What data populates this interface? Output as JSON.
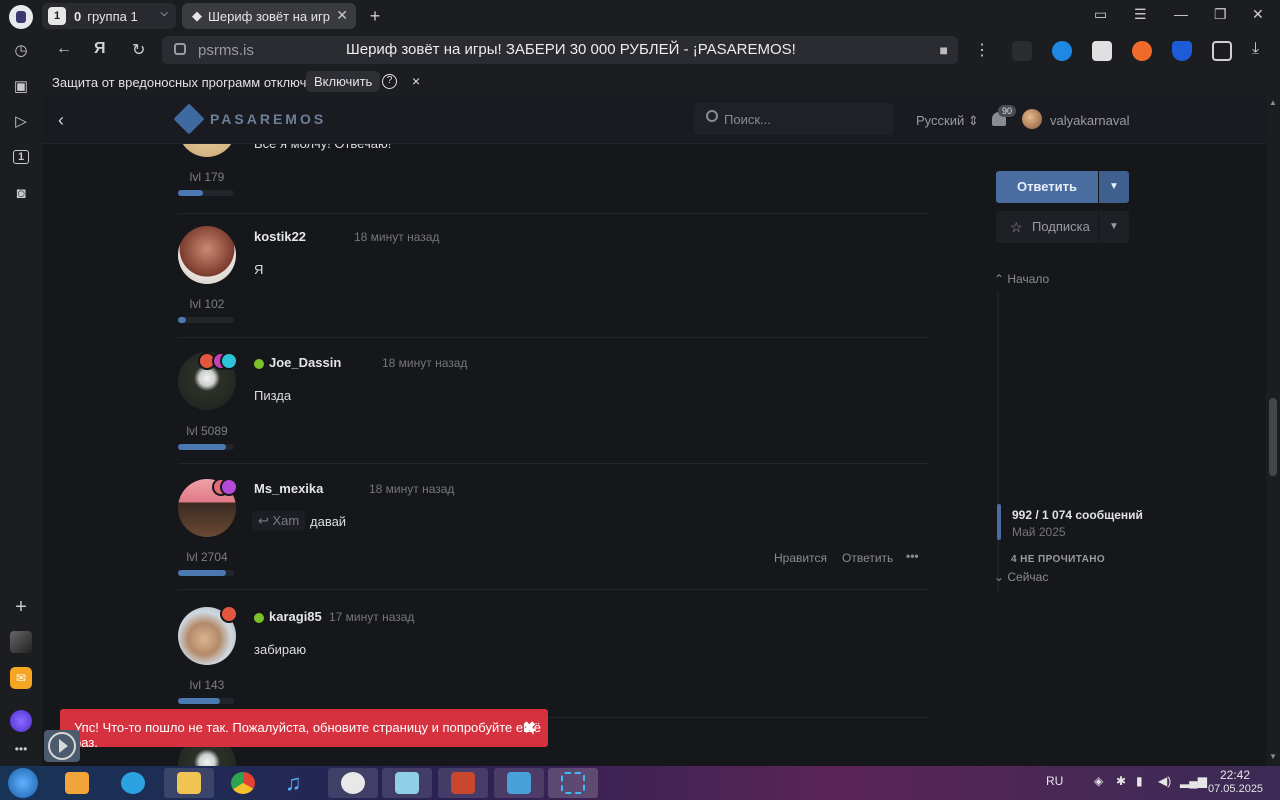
{
  "browser": {
    "tabs": {
      "group_count": "0",
      "group_label": "группа 1",
      "active_tab_title": "Шериф зовёт на игр",
      "tab_count_badge": "1"
    },
    "address": {
      "domain": "psrms.is",
      "page_title": "Шериф зовёт на игры! ЗАБЕРИ 30 000 РУБЛЕЙ - ¡PASAREMOS!"
    },
    "protection": {
      "message": "Защита от вредоносных программ отключена",
      "enable_label": "Включить",
      "help_glyph": "?",
      "close_glyph": "×"
    },
    "sidebar_badge": "1"
  },
  "site": {
    "logo_text": "PASAREMOS",
    "search_placeholder": "Поиск...",
    "language": "Русский",
    "notification_count": "90",
    "username": "valyakarnaval"
  },
  "posts": [
    {
      "author": "",
      "time": "",
      "text": "Все я молчу! Отвечаю!",
      "level": "lvl 179",
      "level_progress": 0.45
    },
    {
      "author": "kostik22",
      "time": "18 минут назад",
      "text": "Я",
      "level": "lvl 102",
      "level_progress": 0.15
    },
    {
      "author": "Joe_Dassin",
      "time": "18 минут назад",
      "text": "Пизда",
      "level": "lvl 5089",
      "level_progress": 0.85,
      "online": true
    },
    {
      "author": "Ms_mexika",
      "time": "18 минут назад",
      "quote_author": "Xam",
      "text": "давай",
      "level": "lvl 2704",
      "level_progress": 0.85,
      "actions": {
        "like": "Нравится",
        "reply": "Ответить",
        "more": "•••"
      }
    },
    {
      "author": "karagi85",
      "time": "17 минут назад",
      "text": "забираю",
      "level": "lvl 143",
      "level_progress": 0.75,
      "online": true
    }
  ],
  "right_panel": {
    "reply_label": "Ответить",
    "subscribe_label": "Подписка",
    "timeline_start": "Начало",
    "timeline_count": "992 / 1 074 сообщений",
    "timeline_date": "Май 2025",
    "timeline_unread": "4 НЕ ПРОЧИТАНО",
    "timeline_now": "Сейчас"
  },
  "toast": {
    "message": "Упс! Что-то пошло не так. Пожалуйста, обновите страницу и попробуйте ещё раз.",
    "close_glyph": "✖"
  },
  "taskbar": {
    "language": "RU",
    "time": "22:42",
    "date": "07.05.2025"
  },
  "colors": {
    "accent": "#4a6da0",
    "online": "#7cc02a",
    "error": "#d5313f"
  }
}
